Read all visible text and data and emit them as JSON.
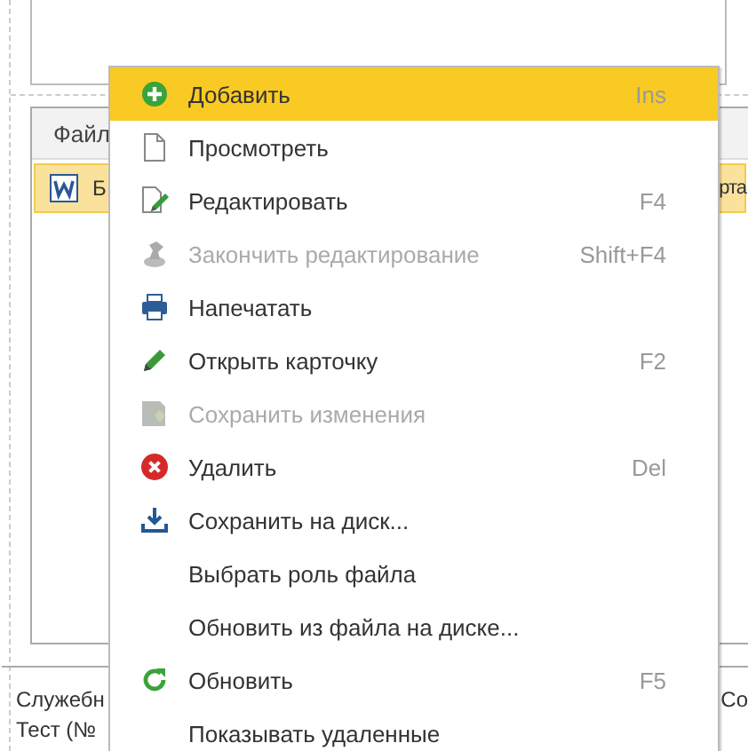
{
  "background": {
    "table": {
      "header": "Файл",
      "rows": [
        {
          "selected": true,
          "kind": "word",
          "cell_1": "Б",
          "cell_2": "рта"
        }
      ]
    },
    "footer": {
      "lines": [
        "Служебн",
        "Тест (№"
      ],
      "right": "Со"
    }
  },
  "context_menu": {
    "items": [
      {
        "label": "Добавить",
        "shortcut": "Ins",
        "kind": "add",
        "selected": true,
        "disabled": false
      },
      {
        "label": "Просмотреть",
        "kind": "page",
        "selected": false,
        "disabled": false
      },
      {
        "label": "Редактировать",
        "shortcut": "F4",
        "kind": "edit",
        "selected": false,
        "disabled": false
      },
      {
        "label": "Закончить редактирование",
        "shortcut": "Shift+F4",
        "kind": "stamp",
        "selected": false,
        "disabled": true
      },
      {
        "label": "Напечатать",
        "kind": "print",
        "selected": false,
        "disabled": false
      },
      {
        "label": "Открыть карточку",
        "shortcut": "F2",
        "kind": "pencil",
        "selected": false,
        "disabled": false
      },
      {
        "label": "Сохранить изменения",
        "kind": "save",
        "selected": false,
        "disabled": true
      },
      {
        "label": "Удалить",
        "shortcut": "Del",
        "kind": "delete",
        "selected": false,
        "disabled": false
      },
      {
        "label": "Сохранить на диск...",
        "kind": "download",
        "selected": false,
        "disabled": false
      },
      {
        "label": "Выбрать роль файла",
        "kind": "plain",
        "selected": false,
        "disabled": false
      },
      {
        "label": "Обновить из файла на диске...",
        "kind": "plain",
        "selected": false,
        "disabled": false
      },
      {
        "label": "Обновить",
        "shortcut": "F5",
        "kind": "refresh",
        "selected": false,
        "disabled": false
      },
      {
        "label": "Показывать удаленные",
        "kind": "plain",
        "selected": false,
        "disabled": false
      }
    ]
  }
}
